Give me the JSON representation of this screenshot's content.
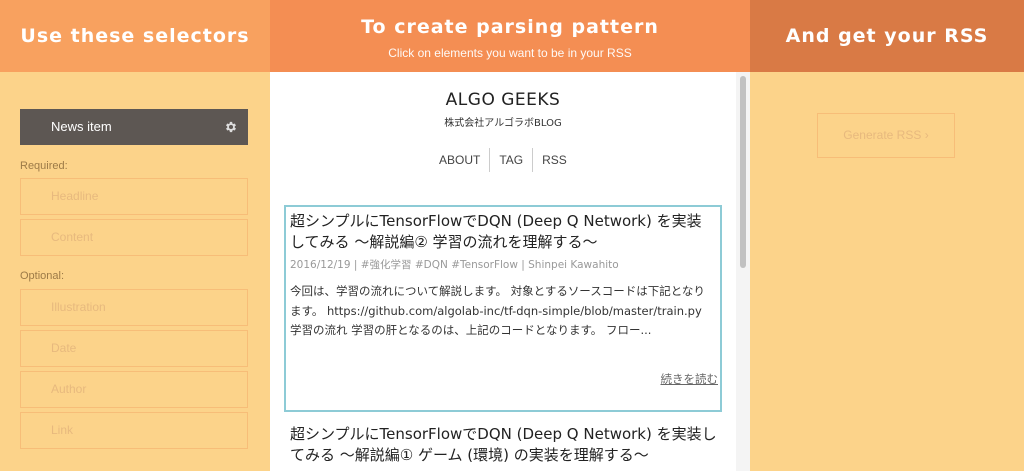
{
  "headers": {
    "left_title": "Use these selectors",
    "mid_title": "To create parsing pattern",
    "mid_subtitle": "Click on elements you want to be in your RSS",
    "right_title": "And get your RSS"
  },
  "selectors": {
    "news_item_label": "News item",
    "required_label": "Required:",
    "required": [
      "Headline",
      "Content"
    ],
    "optional_label": "Optional:",
    "optional": [
      "Illustration",
      "Date",
      "Author",
      "Link"
    ]
  },
  "preview": {
    "blog_title": "ALGO GEEKS",
    "blog_subtitle": "株式会社アルゴラボBLOG",
    "nav": [
      "ABOUT",
      "TAG",
      "RSS"
    ],
    "posts": [
      {
        "title": "超シンプルにTensorFlowでDQN (Deep Q Network) を実装してみる 〜解説編② 学習の流れを理解する〜",
        "meta": "2016/12/19 | #強化学習 #DQN #TensorFlow | Shinpei Kawahito",
        "excerpt": "今回は、学習の流れについて解説します。 対象とするソースコードは下記となります。 https://github.com/algolab-inc/tf-dqn-simple/blob/master/train.py 学習の流れ 学習の肝となるのは、上記のコードとなります。 フロー...",
        "read_more": "続きを読む"
      },
      {
        "title": "超シンプルにTensorFlowでDQN (Deep Q Network) を実装してみる 〜解説編① ゲーム (環境) の実装を理解する〜"
      }
    ]
  },
  "output": {
    "generate_label": "Generate RSS",
    "generate_chevron": "›"
  },
  "colors": {
    "background": "#fcd38a",
    "header_left": "#f8a15f",
    "header_mid": "#f48e53",
    "header_right": "#d97a45",
    "active_selector": "#5d5753",
    "highlight_border": "#8dcbd6"
  }
}
